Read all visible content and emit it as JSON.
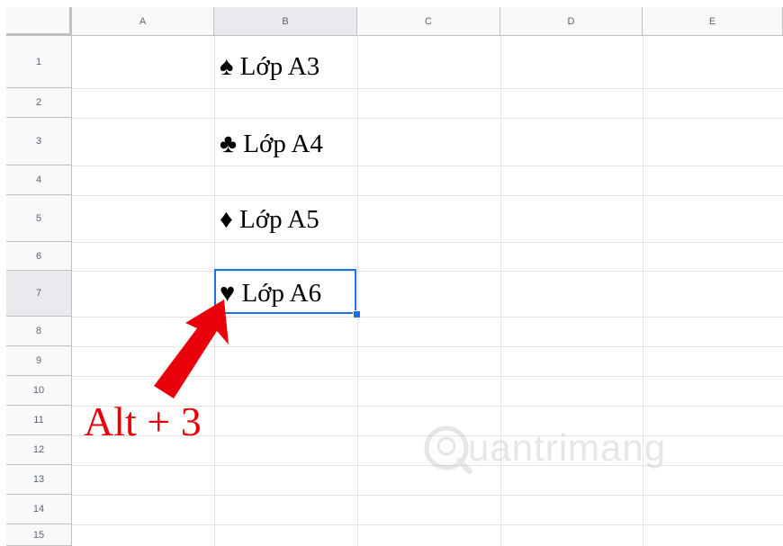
{
  "sheet": {
    "columns": [
      "A",
      "B",
      "C",
      "D",
      "E"
    ],
    "rows": [
      "1",
      "2",
      "3",
      "4",
      "5",
      "6",
      "7",
      "8",
      "9",
      "10",
      "11",
      "12",
      "13",
      "14",
      "15"
    ],
    "selected_cell": "B7",
    "cells": {
      "B1": "♠ Lớp A3",
      "B3": "♣ Lớp A4",
      "B5": "♦ Lớp A5",
      "B7": "♥ Lớp A6"
    }
  },
  "annotation": {
    "text": "Alt + 3",
    "color": "#e8000b"
  },
  "watermark": {
    "text": "uantrimang",
    "logo_letter": "Q"
  },
  "colors": {
    "selection": "#1a73e8",
    "header_bg": "#f8f9fa",
    "gridline": "#e2e3e3"
  }
}
